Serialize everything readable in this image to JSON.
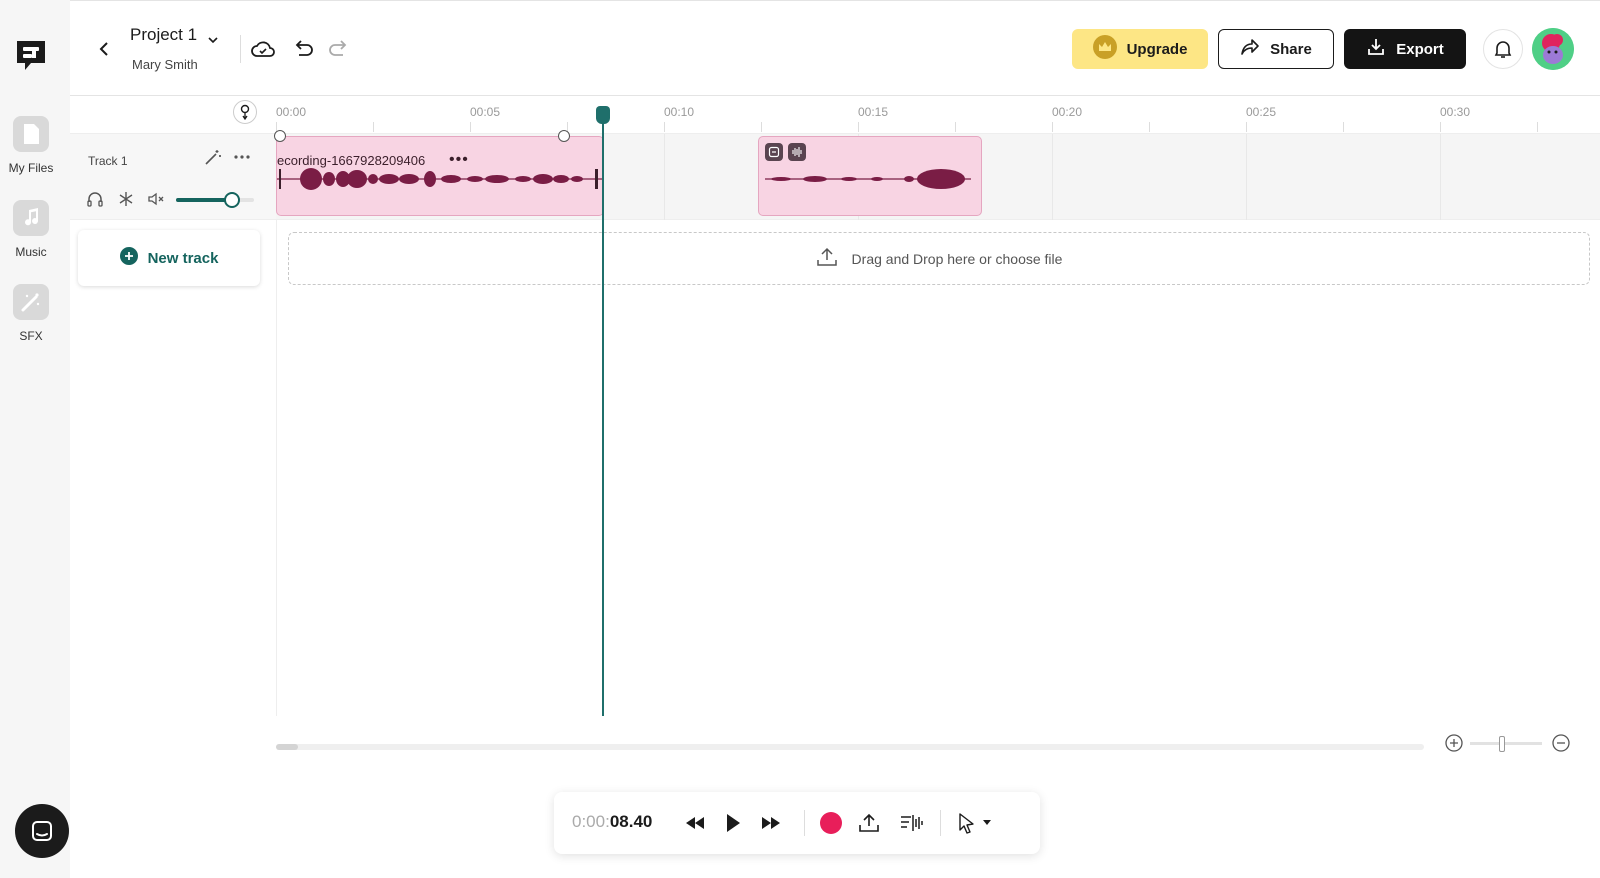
{
  "header": {
    "project_title": "Project 1",
    "owner": "Mary Smith",
    "upgrade_label": "Upgrade",
    "share_label": "Share",
    "export_label": "Export"
  },
  "sidebar": {
    "items": [
      {
        "label": "My Files",
        "icon": "file-icon"
      },
      {
        "label": "Music",
        "icon": "music-note-icon"
      },
      {
        "label": "SFX",
        "icon": "magic-wand-icon"
      }
    ]
  },
  "timeline": {
    "ticks": [
      "00:00",
      "00:05",
      "00:10",
      "00:15",
      "00:20",
      "00:25",
      "00:30"
    ],
    "playhead_time": "0:00:08.40"
  },
  "tracks": [
    {
      "name": "Track 1",
      "volume": 0.72,
      "clips": [
        {
          "name": "ecording-1667928209406",
          "more": "•••"
        },
        {
          "name": ""
        }
      ]
    }
  ],
  "new_track_label": "New track",
  "dropzone_label": "Drag and Drop here or choose file",
  "transport": {
    "time_dim": "0:00:",
    "time_bright": "08.40"
  },
  "colors": {
    "accent": "#15645e",
    "clip_bg": "#f8d4e3",
    "waveform": "#7a1d45",
    "upgrade": "#fde685",
    "record": "#e81e5a"
  }
}
